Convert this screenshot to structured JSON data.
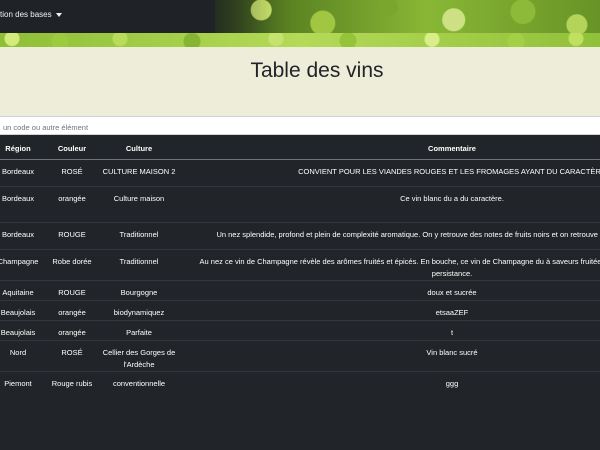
{
  "navbar": {
    "menu_label": "tion des bases"
  },
  "page": {
    "title": "Table des vins"
  },
  "search": {
    "placeholder": "un code ou autre élément"
  },
  "table": {
    "headers": {
      "region": "Région",
      "couleur": "Couleur",
      "culture": "Culture",
      "commentaire": "Commentaire"
    },
    "rows": [
      {
        "region": "Bordeaux",
        "couleur": "ROSÉ",
        "culture": "CULTURE MAISON 2",
        "commentaire": "CONVIENT POUR LES VIANDES ROUGES ET LES FROMAGES AYANT DU CARACTÈRE"
      },
      {
        "region": "Bordeaux",
        "couleur": "orangée",
        "culture": "Culture maison",
        "commentaire": "Ce vin blanc du a du caractère."
      },
      {
        "region": "Bordeaux",
        "couleur": "ROUGE",
        "culture": "Traditionnel",
        "commentaire": "Un nez splendide, profond et plein de complexité aromatique. On y retrouve des notes de fruits noirs et on retrouve toute la puissance du fruit."
      },
      {
        "region": "Champagne",
        "couleur": "Robe dorée",
        "culture": "Traditionnel",
        "commentaire": "Au nez ce vin de Champagne révèle des arômes fruités et épicés. En bouche, ce vin de Champagne du à saveurs fruitées et acidulées avec une longue persistance."
      },
      {
        "region": "Aquitaine",
        "couleur": "ROUGE",
        "culture": "Bourgogne",
        "commentaire": "doux et sucrée"
      },
      {
        "region": "Beaujolais",
        "couleur": "orangée",
        "culture": "biodynamiquez",
        "commentaire": "etsaaZEF"
      },
      {
        "region": "Beaujolais",
        "couleur": "orangée",
        "culture": "Parfaite",
        "commentaire": "t"
      },
      {
        "region": "Nord",
        "couleur": "ROSÉ",
        "culture": "Cellier des Gorges de l'Ardèche",
        "commentaire": "Vin blanc sucré"
      },
      {
        "region": "Piemont",
        "couleur": "Rouge rubis",
        "culture": "conventionnelle",
        "commentaire": "ggg"
      }
    ]
  }
}
